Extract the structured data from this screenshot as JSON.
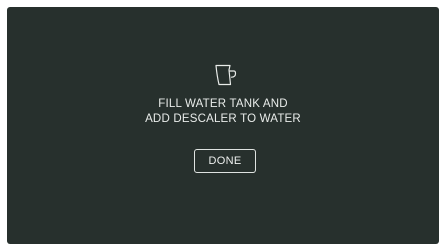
{
  "screen": {
    "icon": "water-jug-icon",
    "message": {
      "line1": "FILL WATER TANK AND",
      "line2": "ADD DESCALER TO WATER"
    },
    "done_label": "DONE",
    "colors": {
      "background": "#27302d",
      "text": "#e9ecea",
      "outline": "#dfe3e1"
    }
  }
}
